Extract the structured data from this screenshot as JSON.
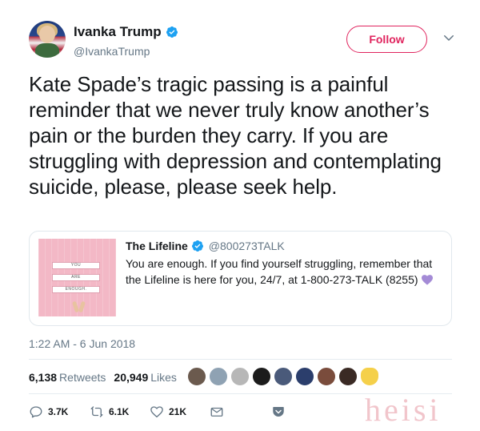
{
  "author": {
    "display_name": "Ivanka Trump",
    "handle": "@IvankaTrump",
    "avatar_icon": "profile-photo",
    "verified_icon": "verified-badge-icon"
  },
  "follow_button": {
    "label": "Follow",
    "color": "#e0245e"
  },
  "tweet": {
    "text": "Kate Spade’s tragic passing is a painful reminder that we never truly know another’s pain or the burden they carry. If you are struggling with depression and contemplating suicide, please, please seek help."
  },
  "quoted_tweet": {
    "display_name": "The Lifeline",
    "handle": "@800273TALK",
    "text": "You are enough. If you find yourself struggling, remember that the Lifeline is here for you, 24/7, at 1-800-273-TALK (8255)",
    "emoji_icon": "purple-heart-icon",
    "image_signs": [
      "YOU",
      "ARE",
      "ENOUGH."
    ]
  },
  "timestamp": "1:22 AM - 6 Jun 2018",
  "stats": {
    "retweets_count": "6,138",
    "retweets_label": "Retweets",
    "likes_count": "20,949",
    "likes_label": "Likes"
  },
  "actions": {
    "reply_count": "3.7K",
    "retweet_count": "6.1K",
    "like_count": "21K"
  },
  "colors": {
    "accent": "#1da1f2",
    "secondary_text": "#657786",
    "divider": "#e6ecf0"
  },
  "watermark": "heisi"
}
